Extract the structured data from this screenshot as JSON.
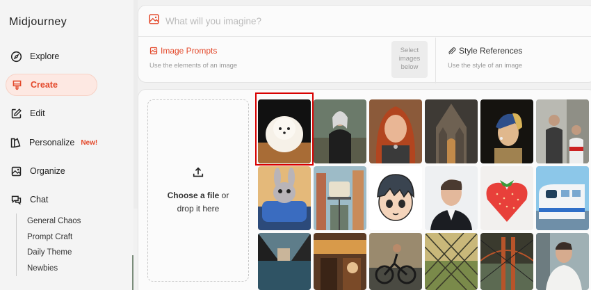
{
  "brand": "Midjourney",
  "nav": {
    "explore": "Explore",
    "create": "Create",
    "edit": "Edit",
    "personalize": "Personalize",
    "personalize_badge": "New!",
    "organize": "Organize",
    "chat": "Chat"
  },
  "chat_channels": [
    "General Chaos",
    "Prompt Craft",
    "Daily Theme",
    "Newbies"
  ],
  "prompt": {
    "placeholder": "What will you imagine?",
    "value": ""
  },
  "image_prompts": {
    "title": "Image Prompts",
    "description": "Use the elements of an image"
  },
  "select_images": "Select images below",
  "style_references": {
    "title": "Style References",
    "description": "Use the style of an image"
  },
  "upload": {
    "line1_bold": "Choose a file",
    "line1_rest": " or",
    "line2": "drop it here"
  },
  "gallery": {
    "selected_index": 0,
    "items": [
      {
        "name": "pomeranian-puppy"
      },
      {
        "name": "white-haired-warrior"
      },
      {
        "name": "redhead-woman-portrait"
      },
      {
        "name": "gothic-cathedral"
      },
      {
        "name": "girl-with-pearl-earring"
      },
      {
        "name": "martial-arts-scene"
      },
      {
        "name": "bunny-on-train"
      },
      {
        "name": "city-monorail"
      },
      {
        "name": "cartoon-boy-face"
      },
      {
        "name": "man-portrait"
      },
      {
        "name": "strawberry-heart"
      },
      {
        "name": "cartoon-bullet-train"
      },
      {
        "name": "seaside-town"
      },
      {
        "name": "street-market"
      },
      {
        "name": "bicycle-street"
      },
      {
        "name": "fence-sunset"
      },
      {
        "name": "golden-gate-bridge"
      },
      {
        "name": "man-white-shirt"
      }
    ]
  },
  "colors": {
    "accent": "#e3482a",
    "selection": "#d80000"
  }
}
